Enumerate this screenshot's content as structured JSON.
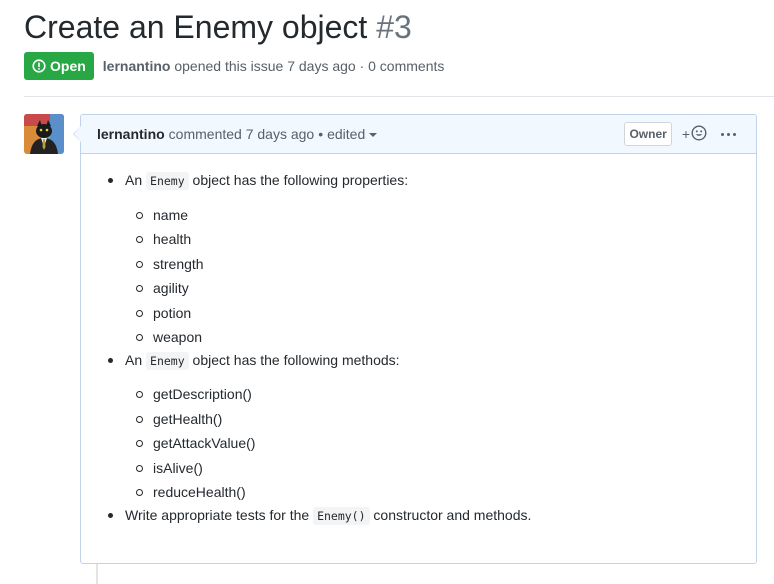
{
  "issue": {
    "title": "Create an Enemy object",
    "number": "#3",
    "status": "Open",
    "status_color": "#28a745",
    "author": "lernantino",
    "opened_text": "opened this issue 7 days ago · 0 comments"
  },
  "comment": {
    "author": "lernantino",
    "action_text": "commented 7 days ago",
    "edited_label": "edited",
    "role_badge": "Owner",
    "reaction_label": "+",
    "header_bg": "#f1f8ff",
    "border_color": "#c0d3eb",
    "body": {
      "item1": {
        "prefix": "An",
        "code": "Enemy",
        "suffix": "object has the following properties:",
        "subitems": [
          "name",
          "health",
          "strength",
          "agility",
          "potion",
          "weapon"
        ]
      },
      "item2": {
        "prefix": "An",
        "code": "Enemy",
        "suffix": "object has the following methods:",
        "subitems": [
          "getDescription()",
          "getHealth()",
          "getAttackValue()",
          "isAlive()",
          "reduceHealth()"
        ]
      },
      "item3": {
        "prefix": "Write appropriate tests for the",
        "code": "Enemy()",
        "suffix": "constructor and methods."
      }
    }
  },
  "icons": {
    "status": "issue-opened-icon",
    "reaction": "smiley-icon",
    "more": "kebab-horizontal-icon",
    "avatar": "cat-in-suit-avatar"
  }
}
